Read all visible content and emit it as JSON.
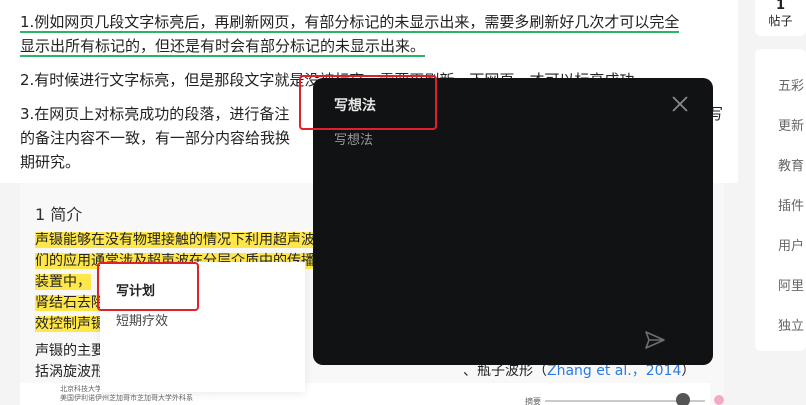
{
  "article": {
    "para1": "1.例如网页几段文字标亮后，再刷新网页，有部分标记的未显示出来，需要多刷新好几次才可以完全",
    "para1b": "显示出所有标记的，但还是有时会有部分标记的未显示出来。",
    "para2": "2.有时候进行文字标亮，但是那段文字就是没被标亮，需要再刷新一下网页，才可以标亮成功。",
    "para3a": "3.在网页上对标亮成功的段落，进行备注",
    "para3a_end": "写",
    "para3b": "的备注内容不一致，有一部分内容给我换",
    "para3c": "期研究。"
  },
  "card": {
    "section_title": "1 简介",
    "hl_lines": [
      "声镊能够在没有物理接触的情况下利用超声波",
      "们的应用通常涉及超声波在分层介质中的传播",
      "装置中，",
      "肾结石去除",
      "效控制声镊"
    ],
    "body_lines": [
      "声镊的主要",
      "括涡旋波形"
    ],
    "right_text_prefix": "、瓶子波形（",
    "right_text_cite": "Zhang et al.，2014",
    "right_text_suffix": "）"
  },
  "paper_strip": {
    "line1": "北京科技大学工业与制造工程专业，北京科技大学，美国",
    "line2": "美国伊利诺伊州芝加哥市芝加哥大学外科系",
    "right_label": "摘要"
  },
  "popup_small": {
    "title": "写计划",
    "item": "短期疗效"
  },
  "dark_panel": {
    "title": "写想法",
    "subtitle": "写想法",
    "close_icon": "close-icon",
    "send_icon": "send-icon"
  },
  "sidebar": {
    "count": "1",
    "count_label": "帖子",
    "items": [
      "五彩",
      "更新",
      "教育",
      "插件",
      "用户",
      "阿里",
      "独立"
    ]
  },
  "colors": {
    "highlight": "#ffe74a",
    "underline": "#28b469",
    "red_annotation": "#e0202a",
    "dark_panel_bg": "#111214",
    "citation": "#2a7ae2"
  }
}
